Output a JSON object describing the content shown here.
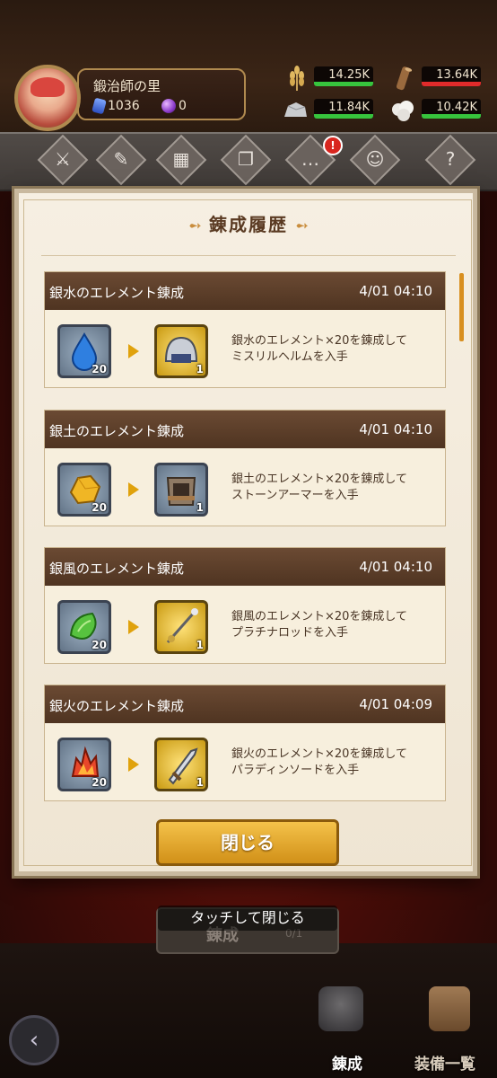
{
  "header": {
    "village_name": "鍛治師の里",
    "gems": "1036",
    "orbs": "0",
    "resources": [
      {
        "name": "wheat-icon",
        "value": "14.25K"
      },
      {
        "name": "wood-icon",
        "value": "13.64K"
      },
      {
        "name": "stone-icon",
        "value": "11.84K"
      },
      {
        "name": "cotton-icon",
        "value": "10.42K"
      }
    ]
  },
  "menu": {
    "badge": "!",
    "icons": [
      "weapons-icon",
      "book-icon",
      "storage-icon",
      "cards-icon",
      "chat-icon",
      "friends-icon",
      "help-icon"
    ]
  },
  "dialog": {
    "title": "錬成履歴",
    "entries": [
      {
        "name": "銀水のエレメント錬成",
        "time": "4/01 04:10",
        "from_count": "20",
        "to_count": "1",
        "line1": "銀水のエレメント×20を錬成して",
        "line2": "ミスリルヘルムを入手"
      },
      {
        "name": "銀土のエレメント錬成",
        "time": "4/01 04:10",
        "from_count": "20",
        "to_count": "1",
        "line1": "銀土のエレメント×20を錬成して",
        "line2": "ストーンアーマーを入手"
      },
      {
        "name": "銀風のエレメント錬成",
        "time": "4/01 04:10",
        "from_count": "20",
        "to_count": "1",
        "line1": "銀風のエレメント×20を錬成して",
        "line2": "プラチナロッドを入手"
      },
      {
        "name": "銀火のエレメント錬成",
        "time": "4/01 04:09",
        "from_count": "20",
        "to_count": "1",
        "line1": "銀火のエレメント×20を錬成して",
        "line2": "パラディンソードを入手"
      }
    ],
    "close_label": "閉じる"
  },
  "under": {
    "button_label": "錬成",
    "button_count": "0/1",
    "toast": "タッチして閉じる"
  },
  "bottom_nav": {
    "forge_label": "錬成",
    "equip_label": "装備一覧"
  }
}
